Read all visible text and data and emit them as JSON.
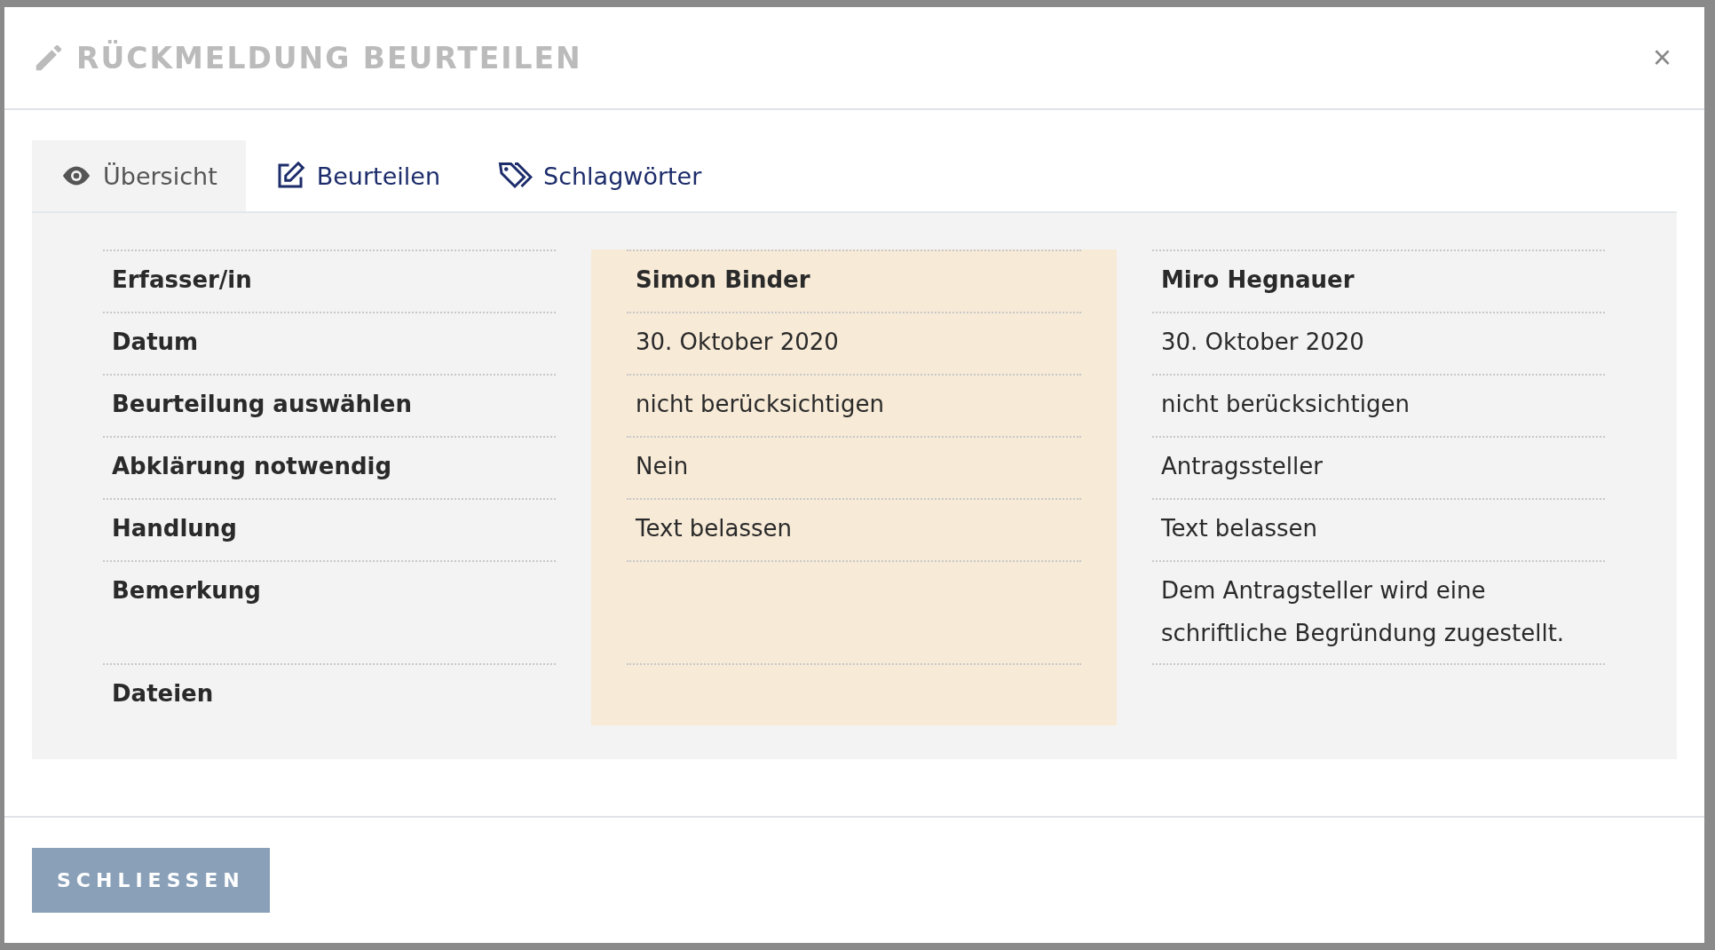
{
  "dialog": {
    "title": "RÜCKMELDUNG BEURTEILEN",
    "close": "×"
  },
  "tabs": [
    {
      "label": "Übersicht",
      "selected": true
    },
    {
      "label": "Beurteilen",
      "selected": false
    },
    {
      "label": "Schlagwörter",
      "selected": false
    }
  ],
  "columns": [
    {
      "highlighted": true
    },
    {
      "highlighted": false
    }
  ],
  "rows": [
    {
      "label": "Erfasser/in",
      "column_1": "Simon Binder",
      "column_2": "Miro Hegnauer"
    },
    {
      "label": "Datum",
      "column_1": "30. Oktober 2020",
      "column_2": "30. Oktober 2020"
    },
    {
      "label": "Beurteilung auswählen",
      "column_1": "nicht berücksichtigen",
      "column_2": "nicht berücksichtigen"
    },
    {
      "label": "Abklärung notwendig",
      "column_1": "Nein",
      "column_2": "Antragssteller"
    },
    {
      "label": "Handlung",
      "column_1": "Text belassen",
      "column_2": "Text belassen"
    },
    {
      "label": "Bemerkung",
      "column_2": "Dem Antragsteller wird eine schriftliche Begründung zugestellt."
    },
    {
      "label": "Dateien"
    }
  ],
  "buttons": [
    {
      "label": "SCHLIESSEN"
    }
  ]
}
